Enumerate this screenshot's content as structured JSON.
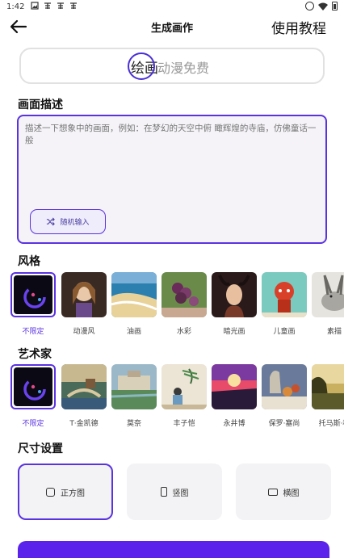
{
  "status_bar": {
    "time": "1:42",
    "notif_icons": [
      "image-icon",
      "app-icon",
      "app-icon",
      "app-icon"
    ],
    "right_icons": [
      "do-not-disturb-icon",
      "wifi-icon",
      "battery-icon"
    ]
  },
  "header": {
    "title": "生成画作",
    "tutorial_label": "使用教程"
  },
  "mode": {
    "active": "绘画",
    "inactive": "动漫免费"
  },
  "description": {
    "label": "画面描述",
    "placeholder": "描述一下想象中的画面，例如：在梦幻的天空中俯 瞰辉煌的寺庙，仿佛童话一般",
    "random_button": "随机输入"
  },
  "style": {
    "label": "风格",
    "items": [
      {
        "label": "不限定",
        "selected": true
      },
      {
        "label": "动漫风",
        "selected": false
      },
      {
        "label": "油画",
        "selected": false
      },
      {
        "label": "水彩",
        "selected": false
      },
      {
        "label": "暗光画",
        "selected": false
      },
      {
        "label": "儿童画",
        "selected": false
      },
      {
        "label": "素描",
        "selected": false
      }
    ]
  },
  "artist": {
    "label": "艺术家",
    "items": [
      {
        "label": "不限定",
        "selected": true
      },
      {
        "label": "T·金凯德",
        "selected": false
      },
      {
        "label": "莫奈",
        "selected": false
      },
      {
        "label": "丰子恺",
        "selected": false
      },
      {
        "label": "永井博",
        "selected": false
      },
      {
        "label": "保罗·塞尚",
        "selected": false
      },
      {
        "label": "托马斯·科",
        "selected": false
      }
    ]
  },
  "size": {
    "label": "尺寸设置",
    "options": [
      {
        "label": "正方图",
        "icon": "square-icon",
        "selected": true
      },
      {
        "label": "竖图",
        "icon": "portrait-icon",
        "selected": false
      },
      {
        "label": "横图",
        "icon": "landscape-icon",
        "selected": false
      }
    ]
  },
  "colors": {
    "accent": "#5a33e0",
    "generate_button": "#5a22ea"
  }
}
